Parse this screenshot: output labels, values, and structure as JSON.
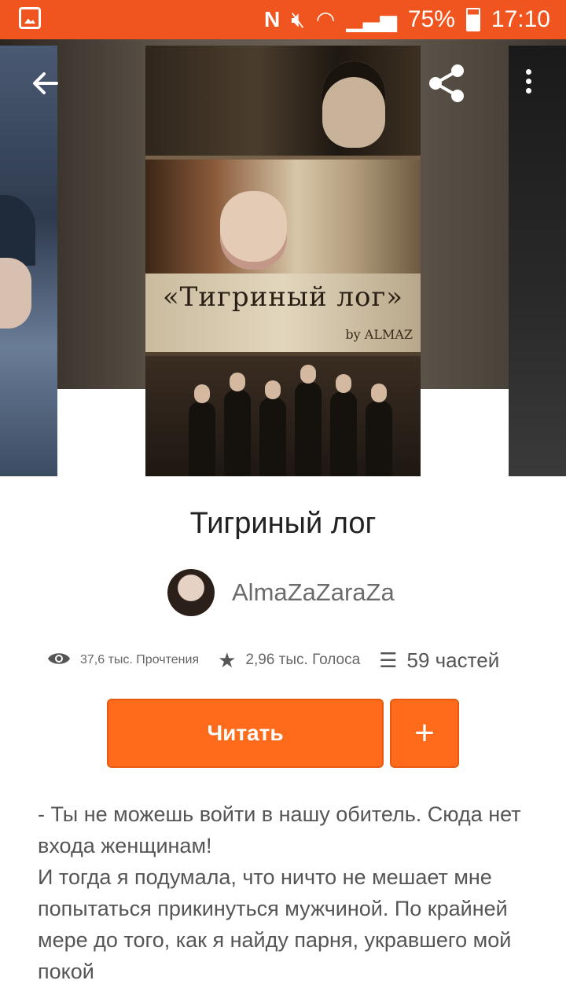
{
  "status_bar": {
    "battery": "75%",
    "time": "17:10",
    "icons": [
      "gallery-icon",
      "n-icon",
      "mute-icon",
      "wifi-icon",
      "signal-icon",
      "battery-icon"
    ]
  },
  "nav": {
    "back_icon": "arrow-left-icon",
    "share_icon": "share-icon",
    "more_icon": "more-vertical-icon"
  },
  "cover": {
    "title_art": "«Тигриный лог»",
    "by_art": "by ALMAZ"
  },
  "story": {
    "title": "Тигриный лог",
    "author": "AlmaZaZaraZa",
    "stats": {
      "reads": "37,6 тыс. Прочтения",
      "votes": "2,96 тыс. Голоса",
      "parts": "59 частей"
    },
    "read_button": "Читать",
    "add_button": "+",
    "description": [
      "- Ты не можешь войти в нашу обитель. Сюда нет входа женщинам!",
      "И тогда я подумала, что ничто не мешает мне попытаться прикинуться мужчиной. По крайней мере до того, как я найду парня, укравшего мой покой"
    ]
  },
  "colors": {
    "accent": "#ff6b1a",
    "status_bar": "#f0551f"
  }
}
